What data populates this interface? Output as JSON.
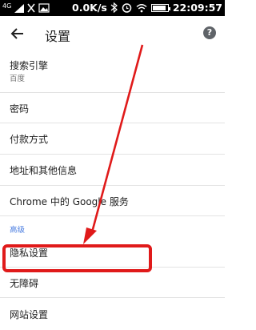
{
  "status_bar": {
    "network": "4G",
    "speed": "0.0K/s",
    "time": "22:09:57",
    "battery_level": 0.9
  },
  "toolbar": {
    "title": "设置"
  },
  "settings": {
    "search_engine": {
      "label": "搜索引擎",
      "value": "百度"
    },
    "passwords": "密码",
    "payment_methods": "付款方式",
    "addresses": "地址和其他信息",
    "google_in_chrome": "Chrome 中的 Google 服务",
    "advanced_header": "高级",
    "privacy": "隐私设置",
    "accessibility": "无障碍",
    "site_settings": "网站设置"
  },
  "colors": {
    "annotation": "#e01a1a",
    "section_header": "#4a7de0"
  }
}
